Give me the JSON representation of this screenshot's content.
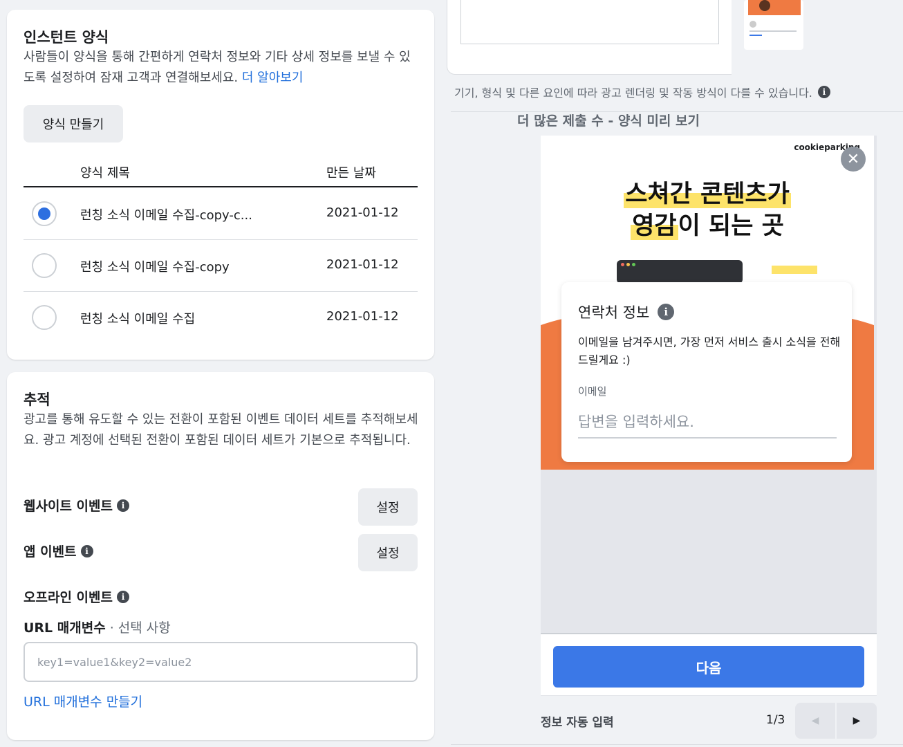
{
  "lead_form": {
    "title": "인스턴트 양식",
    "description": "사람들이 양식을 통해 간편하게 연락처 정보와 기타 상세 정보를 보낼 수 있도록 설정하여 잠재 고객과 연결해보세요.",
    "learn_more": "더 알아보기",
    "create_button": "양식 만들기",
    "columns": {
      "title": "양식 제목",
      "date": "만든 날짜"
    },
    "rows": [
      {
        "title": "런칭 소식 이메일 수집-copy-c...",
        "date": "2021-01-12",
        "selected": true
      },
      {
        "title": "런칭 소식 이메일 수집-copy",
        "date": "2021-01-12",
        "selected": false
      },
      {
        "title": "런칭 소식 이메일 수집",
        "date": "2021-01-12",
        "selected": false
      }
    ]
  },
  "tracking": {
    "title": "추적",
    "description": "광고를 통해 유도할 수 있는 전환이 포함된 이벤트 데이터 세트를 추적해보세요. 광고 계정에 선택된 전환이 포함된 데이터 세트가 기본으로 추적됩니다.",
    "website_events": "웹사이트 이벤트",
    "app_events": "앱 이벤트",
    "offline_events": "오프라인 이벤트",
    "setup_label": "설정",
    "url_params_label": "URL 매개변수",
    "url_params_optional": "· 선택 사항",
    "url_params_placeholder": "key1=value1&key2=value2",
    "build_url_link": "URL 매개변수 만들기"
  },
  "preview": {
    "disclaimer": "기기, 형식 및 다른 요인에 따라 광고 렌더링 및 작동 방식이 다를 수 있습니다.",
    "title": "더 많은 제출 수 - 양식 미리 보기",
    "brand": "cookieparking",
    "hero_line1": "스쳐간 콘텐츠가",
    "hero_line2_hl": "영감",
    "hero_line2_rest": "이 되는 곳",
    "contact_title": "연락처 정보",
    "contact_desc": "이메일을 남겨주시면, 가장 먼저 서비스 출시 소식을 전해드릴게요 :)",
    "email_label": "이메일",
    "email_placeholder": "답변을 입력하세요.",
    "next_button": "다음",
    "autofill_label": "정보 자동 입력",
    "page_indicator": "1/3",
    "accent_color": "#3b78e7",
    "hero_orange": "#ef7a42"
  }
}
